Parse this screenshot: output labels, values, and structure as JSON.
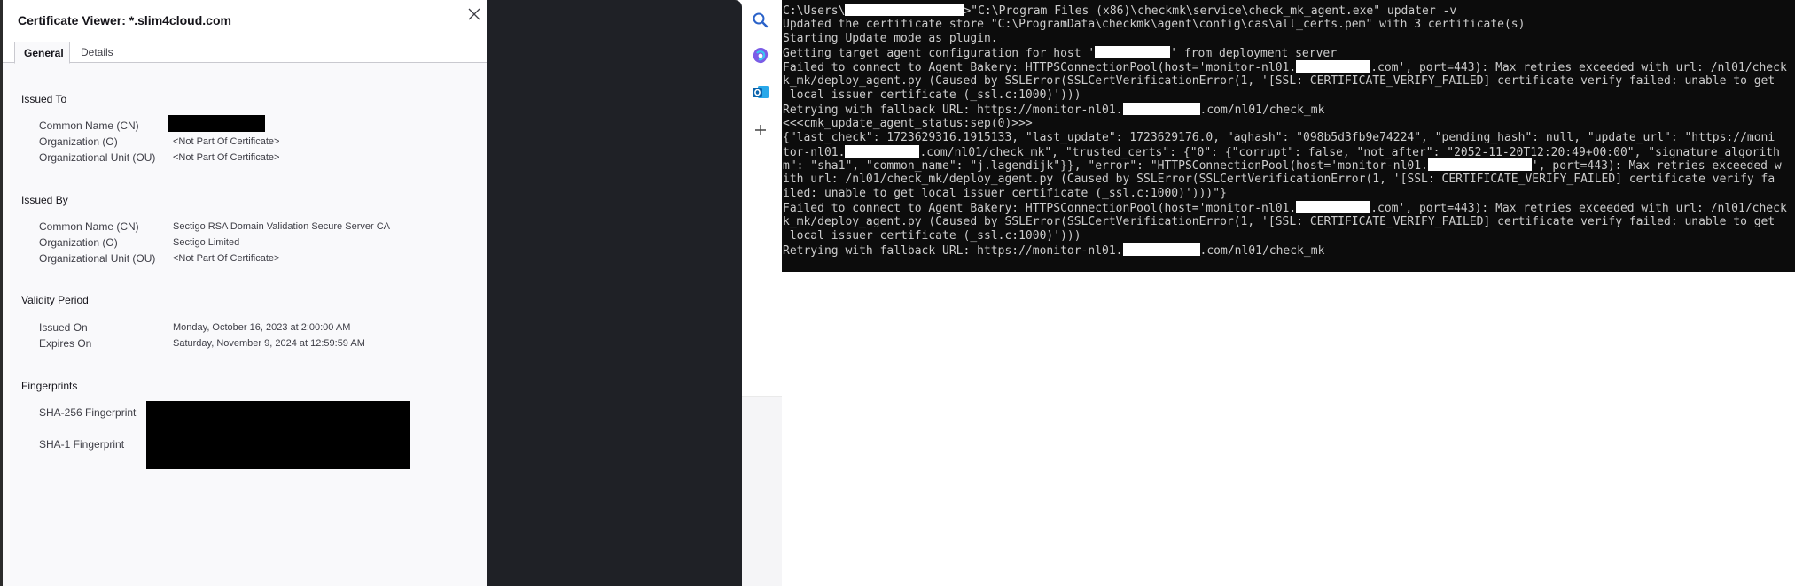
{
  "cert": {
    "title": "Certificate Viewer: *.slim4cloud.com",
    "tabs": [
      "General",
      "Details"
    ],
    "issued_to": {
      "title": "Issued To",
      "cn_label": "Common Name (CN)",
      "o_label": "Organization (O)",
      "o_value": "<Not Part Of Certificate>",
      "ou_label": "Organizational Unit (OU)",
      "ou_value": "<Not Part Of Certificate>"
    },
    "issued_by": {
      "title": "Issued By",
      "cn_label": "Common Name (CN)",
      "cn_value": "Sectigo RSA Domain Validation Secure Server CA",
      "o_label": "Organization (O)",
      "o_value": "Sectigo Limited",
      "ou_label": "Organizational Unit (OU)",
      "ou_value": "<Not Part Of Certificate>"
    },
    "validity": {
      "title": "Validity Period",
      "issued_label": "Issued On",
      "issued_value": "Monday, October 16, 2023 at 2:00:00 AM",
      "expires_label": "Expires On",
      "expires_value": "Saturday, November 9, 2024 at 12:59:59 AM"
    },
    "fingerprints": {
      "title": "Fingerprints",
      "sha256_label": "SHA-256 Fingerprint",
      "sha1_label": "SHA-1 Fingerprint"
    }
  },
  "rail": {
    "icons": [
      "search-icon",
      "copilot-icon",
      "outlook-icon",
      "plus-icon"
    ]
  },
  "terminal": {
    "lines": [
      {
        "parts": [
          "C:\\Users\\",
          "",
          ">\"C:\\Program Files (x86)\\checkmk\\service\\check_mk_agent.exe\" updater -v"
        ]
      },
      {
        "parts": [
          "Updated the certificate store \"C:\\ProgramData\\checkmk\\agent\\config\\cas\\all_certs.pem\" with 3 certificate(s)"
        ]
      },
      {
        "parts": [
          "Starting Update mode as plugin."
        ]
      },
      {
        "parts": [
          "Getting target agent configuration for host '",
          "",
          "' from deployment server"
        ]
      },
      {
        "parts": [
          "Failed to connect to Agent Bakery: HTTPSConnectionPool(host='monitor-nl01.",
          "",
          ".com', port=443): Max retries exceeded with url: /nl01/check"
        ]
      },
      {
        "parts": [
          "k_mk/deploy_agent.py (Caused by SSLError(SSLCertVerificationError(1, '[SSL: CERTIFICATE_VERIFY_FAILED] certificate verify failed: unable to get"
        ]
      },
      {
        "parts": [
          " local issuer certificate (_ssl.c:1000)')))"
        ]
      },
      {
        "parts": [
          "Retrying with fallback URL: https://monitor-nl01.",
          "",
          ".com/nl01/check_mk"
        ]
      },
      {
        "parts": [
          "<<<cmk_update_agent_status:sep(0)>>>"
        ]
      },
      {
        "parts": [
          "{\"last_check\": 1723629316.1915133, \"last_update\": 1723629176.0, \"aghash\": \"098b5d3fb9e74224\", \"pending_hash\": null, \"update_url\": \"https://moni"
        ]
      },
      {
        "parts": [
          "tor-nl01.",
          "",
          ".com/nl01/check_mk\", \"trusted_certs\": {\"0\": {\"corrupt\": false, \"not_after\": \"2052-11-20T12:20:49+00:00\", \"signature_algorith"
        ]
      },
      {
        "parts": [
          "m\": \"sha1\", \"common_name\": \"j.lagendijk\"}}, \"error\": \"HTTPSConnectionPool(host='monitor-nl01.",
          "",
          "', port=443): Max retries exceeded w"
        ]
      },
      {
        "parts": [
          "ith url: /nl01/check_mk/deploy_agent.py (Caused by SSLError(SSLCertVerificationError(1, '[SSL: CERTIFICATE_VERIFY_FAILED] certificate verify fa"
        ]
      },
      {
        "parts": [
          "iled: unable to get local issuer certificate (_ssl.c:1000)')))\"}"
        ]
      },
      {
        "parts": [
          "Failed to connect to Agent Bakery: HTTPSConnectionPool(host='monitor-nl01.",
          "",
          ".com', port=443): Max retries exceeded with url: /nl01/check"
        ]
      },
      {
        "parts": [
          "k_mk/deploy_agent.py (Caused by SSLError(SSLCertVerificationError(1, '[SSL: CERTIFICATE_VERIFY_FAILED] certificate verify failed: unable to get"
        ]
      },
      {
        "parts": [
          " local issuer certificate (_ssl.c:1000)')))"
        ]
      },
      {
        "parts": [
          "Retrying with fallback URL: https://monitor-nl01.",
          "",
          ".com/nl01/check_mk"
        ]
      }
    ]
  }
}
